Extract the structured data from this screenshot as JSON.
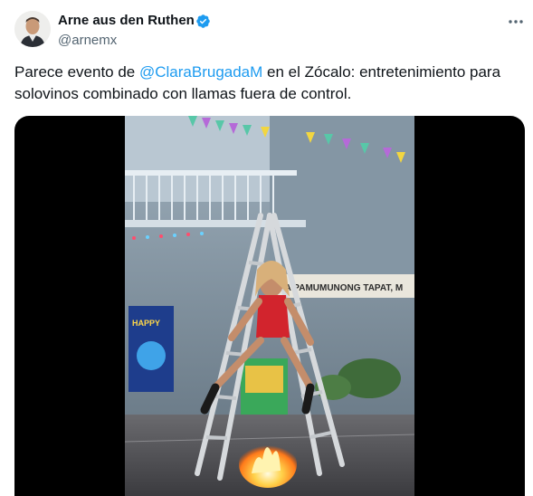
{
  "author": {
    "name": "Arne aus den Ruthen",
    "handle": "@arnemx",
    "verified_icon": "verified-badge-icon",
    "more_icon": "more-options-icon"
  },
  "tweet": {
    "text_before": "Parece evento de ",
    "mention": "@ClaraBrugadaM",
    "text_after": " en el Zócalo: entretenimiento para solovinos combinado con llamas fuera de control."
  },
  "media": {
    "type": "video",
    "poster_text": "SA PAMUMUNONG TAPAT, M",
    "sign_text": "HAPPY"
  },
  "colors": {
    "mention": "#1d9bf0",
    "verified": "#1d9bf0",
    "secondary": "#536471"
  }
}
